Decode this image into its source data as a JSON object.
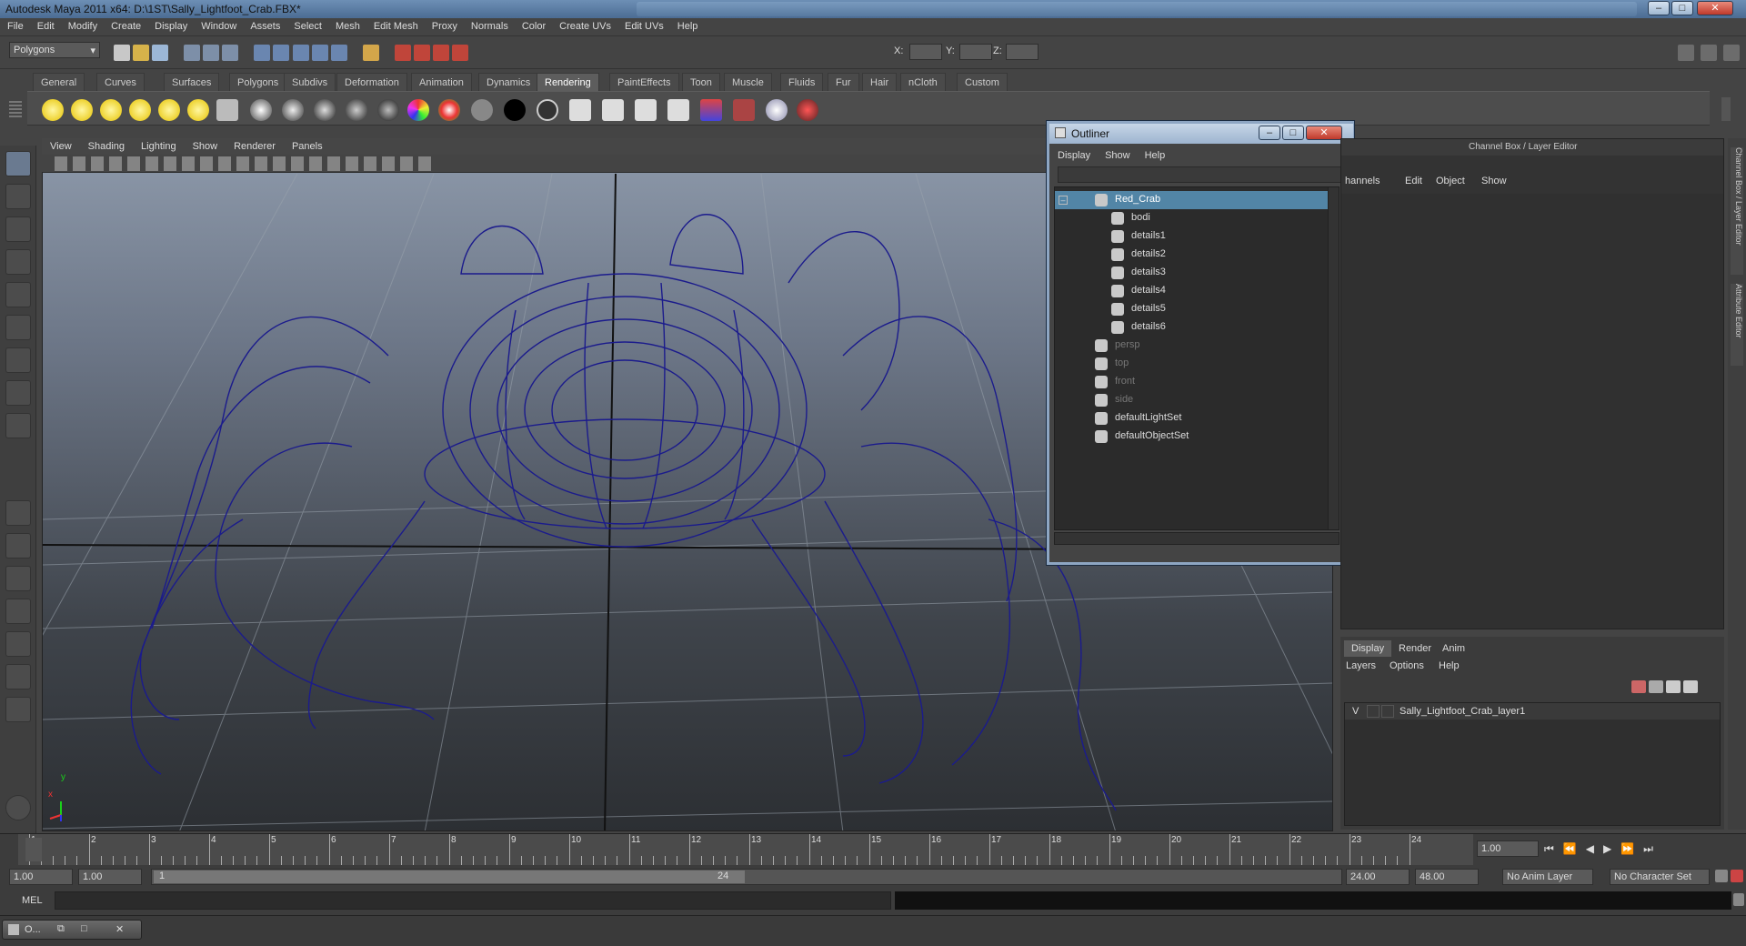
{
  "window": {
    "title": "Autodesk Maya 2011 x64: D:\\1ST\\Sally_Lightfoot_Crab.FBX*"
  },
  "menubar": [
    "File",
    "Edit",
    "Modify",
    "Create",
    "Display",
    "Window",
    "Assets",
    "Select",
    "Mesh",
    "Edit Mesh",
    "Proxy",
    "Normals",
    "Color",
    "Create UVs",
    "Edit UVs",
    "Help"
  ],
  "statusline": {
    "mode": "Polygons",
    "x_label": "X:",
    "y_label": "Y:",
    "z_label": "Z:"
  },
  "shelf_tabs": [
    "General",
    "Curves",
    "Surfaces",
    "Polygons",
    "Subdivs",
    "Deformation",
    "Animation",
    "Dynamics",
    "Rendering",
    "PaintEffects",
    "Toon",
    "Muscle",
    "Fluids",
    "Fur",
    "Hair",
    "nCloth",
    "Custom"
  ],
  "shelf_active": "Rendering",
  "viewport_menu": [
    "View",
    "Shading",
    "Lighting",
    "Show",
    "Renderer",
    "Panels"
  ],
  "viewport": {
    "axis_x": "x",
    "axis_y": "y"
  },
  "outliner": {
    "title": "Outliner",
    "menu": [
      "Display",
      "Show",
      "Help"
    ],
    "items": [
      {
        "label": "Red_Crab",
        "level": 0,
        "state": "selected"
      },
      {
        "label": "bodi",
        "level": 1,
        "state": "normal"
      },
      {
        "label": "details1",
        "level": 1,
        "state": "normal"
      },
      {
        "label": "details2",
        "level": 1,
        "state": "normal"
      },
      {
        "label": "details3",
        "level": 1,
        "state": "normal"
      },
      {
        "label": "details4",
        "level": 1,
        "state": "normal"
      },
      {
        "label": "details5",
        "level": 1,
        "state": "normal"
      },
      {
        "label": "details6",
        "level": 1,
        "state": "normal"
      },
      {
        "label": "persp",
        "level": 0,
        "state": "dim"
      },
      {
        "label": "top",
        "level": 0,
        "state": "dim"
      },
      {
        "label": "front",
        "level": 0,
        "state": "dim"
      },
      {
        "label": "side",
        "level": 0,
        "state": "dim"
      },
      {
        "label": "defaultLightSet",
        "level": 0,
        "state": "normal"
      },
      {
        "label": "defaultObjectSet",
        "level": 0,
        "state": "normal"
      }
    ]
  },
  "channelbox": {
    "title": "Channel Box / Layer Editor",
    "menu": [
      "hannels",
      "Edit",
      "Object",
      "Show"
    ]
  },
  "layer_editor": {
    "tabs": [
      "Display",
      "Render",
      "Anim"
    ],
    "menu": [
      "Layers",
      "Options",
      "Help"
    ],
    "layers": [
      {
        "visible": "V",
        "name": "Sally_Lightfoot_Crab_layer1"
      }
    ]
  },
  "side_tabs": [
    "Channel Box / Layer Editor",
    "Attribute Editor"
  ],
  "timeline": {
    "ticks": [
      "1",
      "2",
      "3",
      "4",
      "5",
      "6",
      "7",
      "8",
      "9",
      "10",
      "11",
      "12",
      "13",
      "14",
      "15",
      "16",
      "17",
      "18",
      "19",
      "20",
      "21",
      "22",
      "23",
      "24"
    ],
    "current_frame": "1.00"
  },
  "range": {
    "start": "1.00",
    "start2": "1.00",
    "slider_start": "1",
    "slider_end": "24",
    "end": "24.00",
    "end2": "48.00",
    "anim_layer": "No Anim Layer",
    "char_set": "No Character Set"
  },
  "cmdline": {
    "label": "MEL"
  },
  "taskbar": {
    "item": "O..."
  }
}
